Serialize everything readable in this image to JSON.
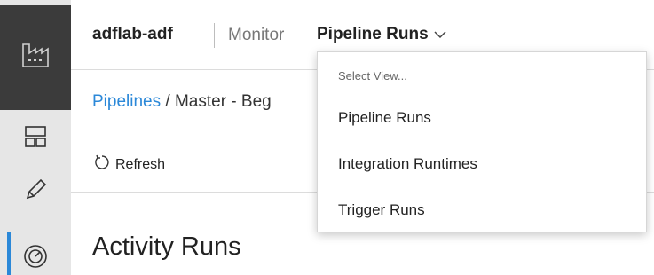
{
  "header": {
    "factory_name": "adflab-adf",
    "section": "Monitor",
    "view_selected": "Pipeline Runs"
  },
  "breadcrumb": {
    "link": "Pipelines",
    "separator": " / ",
    "current": "Master - Beg"
  },
  "toolbar": {
    "refresh_label": "Refresh"
  },
  "main": {
    "title": "Activity Runs"
  },
  "dropdown": {
    "header": "Select View...",
    "options": [
      "Pipeline Runs",
      "Integration Runtimes",
      "Trigger Runs"
    ]
  },
  "sidebar": {
    "icons": [
      "factory-icon",
      "dashboard-icon",
      "pencil-icon",
      "monitor-gauge-icon"
    ]
  },
  "colors": {
    "accent": "#2b88d8",
    "sidebar_dark": "#3b3b3b",
    "sidebar_bg": "#e6e6e6"
  }
}
